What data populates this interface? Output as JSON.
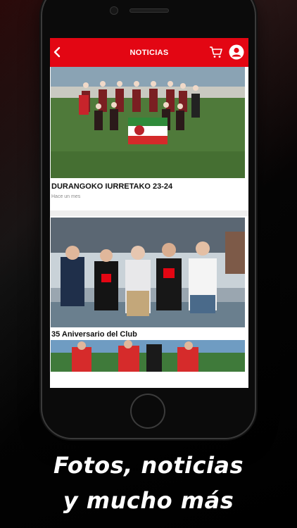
{
  "header": {
    "title": "NOTICIAS"
  },
  "news": [
    {
      "title": "DURANGOKO IURRETAKO 23-24",
      "date": "Hace un mes"
    },
    {
      "title": "35 Aniversario del Club"
    }
  ],
  "caption": {
    "line1": "Fotos, noticias",
    "line2": "y mucho más"
  },
  "colors": {
    "brand_red": "#e30613",
    "background": "#000000"
  },
  "icons": {
    "back": "chevron-left-icon",
    "cart": "cart-icon",
    "user": "user-icon"
  }
}
